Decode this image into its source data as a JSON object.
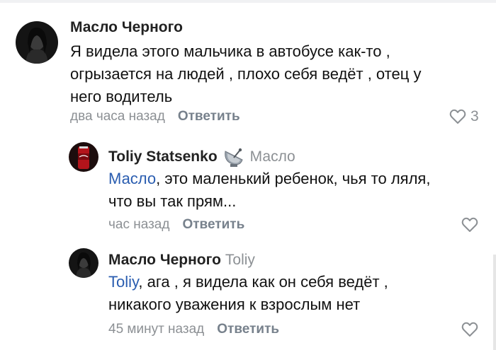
{
  "comments": [
    {
      "author": "Масло Черного",
      "lines": [
        "Я видела этого мальчика в автобусе как-то ,",
        "огрызается на людей , плохо себя ведёт , отец у",
        "него водитель"
      ],
      "time": "два часа назад",
      "reply_label": "Ответить",
      "likes": "3"
    },
    {
      "author": "Toliy Statsenko",
      "badge_icon": "satellite-dish-icon",
      "reply_to": "Масло",
      "mention": "Масло",
      "line1_rest": ", это маленький ребенок, чья то ляля,",
      "line2": "что вы так прям...",
      "time": "час назад",
      "reply_label": "Ответить"
    },
    {
      "author": "Масло Черного",
      "reply_to": "Toliy",
      "mention": "Toliy",
      "line1_rest": ", ага , я видела как он себя ведёт ,",
      "line2": "никакого уважения к взрослым нет",
      "time": "45 минут назад",
      "reply_label": "Ответить"
    }
  ],
  "colors": {
    "mention": "#2a5db0",
    "meta": "#8c9094",
    "reply_button": "#77818c"
  }
}
